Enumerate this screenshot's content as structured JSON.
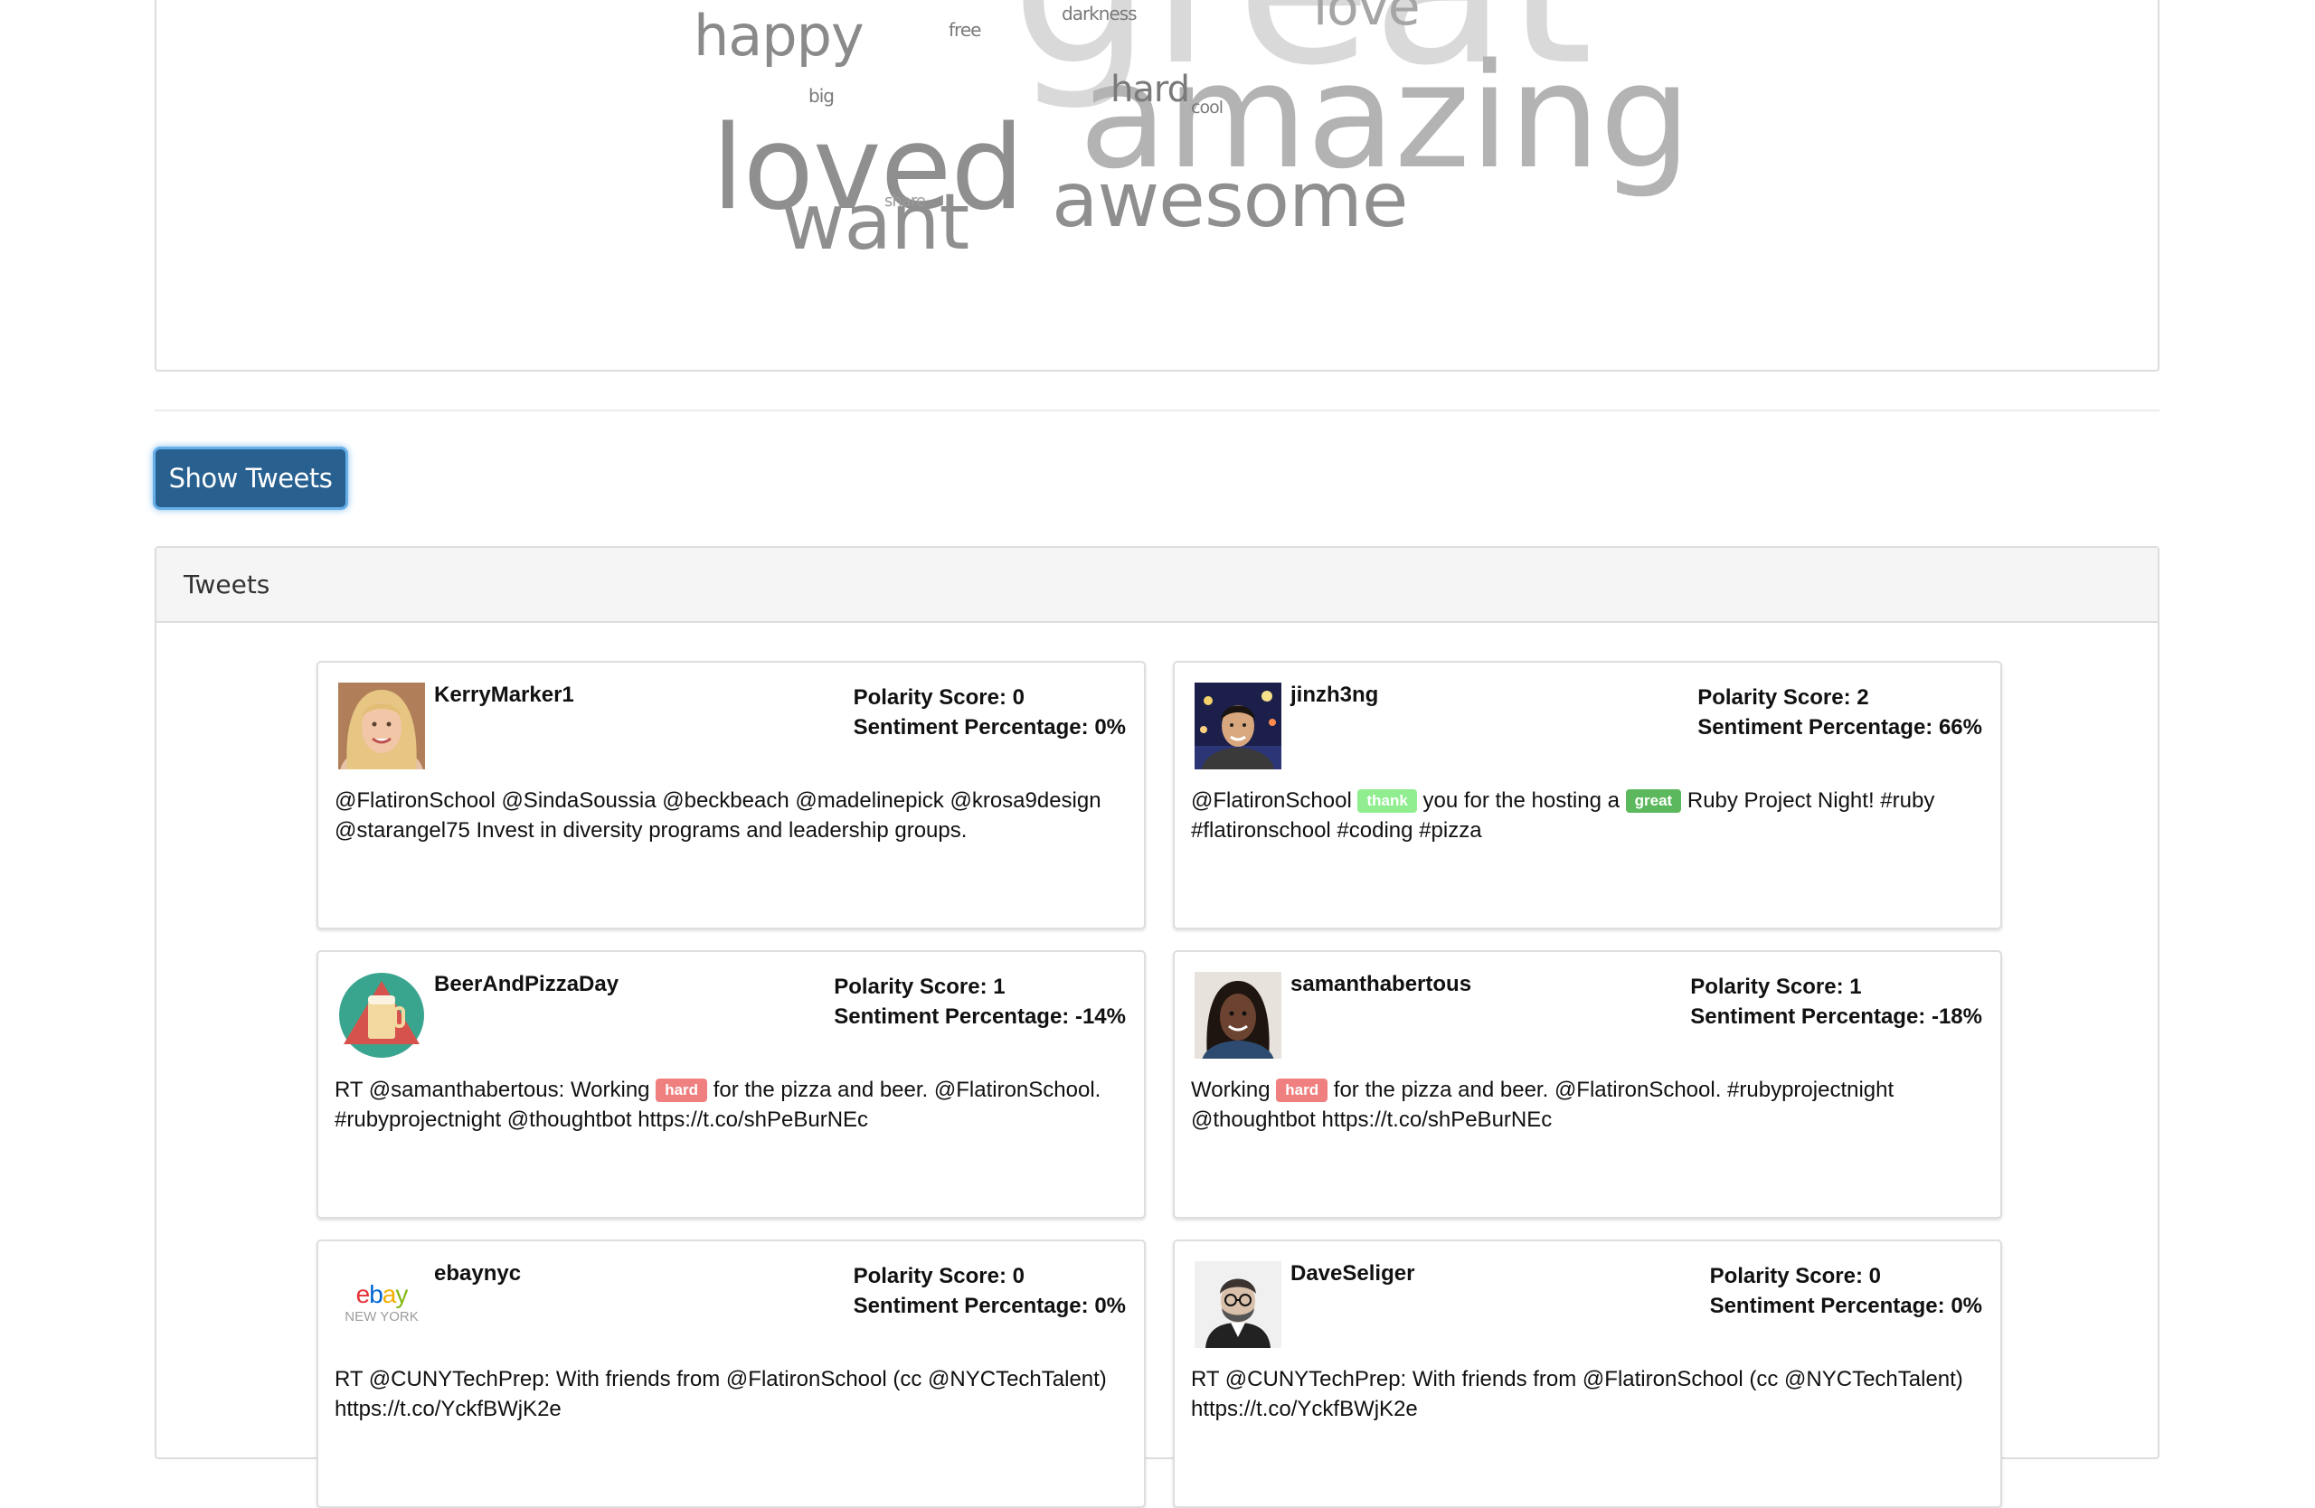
{
  "word_cloud": {
    "words": [
      {
        "text": "great",
        "color": "#d9d9d9"
      },
      {
        "text": "amazing",
        "color": "#b3b3b3"
      },
      {
        "text": "loved",
        "color": "#8f8f8f"
      },
      {
        "text": "want",
        "color": "#8f8f8f"
      },
      {
        "text": "awesome",
        "color": "#8f8f8f"
      },
      {
        "text": "happy",
        "color": "#8a8a8a"
      },
      {
        "text": "love",
        "color": "#a5a5a5"
      },
      {
        "text": "hard",
        "color": "#7a7a7a"
      },
      {
        "text": "darkness",
        "color": "#7a7a7a"
      },
      {
        "text": "free",
        "color": "#7a7a7a"
      },
      {
        "text": "big",
        "color": "#7a7a7a"
      },
      {
        "text": "cool",
        "color": "#7a7a7a"
      },
      {
        "text": "share",
        "color": "#9a9a9a"
      }
    ]
  },
  "show_tweets_button": "Show Tweets",
  "tweets_panel": {
    "title": "Tweets",
    "polarity_label": "Polarity Score:",
    "sentiment_label": "Sentiment Percentage:",
    "cards": [
      {
        "user": "KerryMarker1",
        "polarity": "0",
        "sentiment": "0%",
        "avatar": "kerry",
        "parts": [
          {
            "t": "@FlatironSchool @SindaSoussia @beckbeach @madelinepick @krosa9design @starangel75 Invest in diversity programs and leadership groups."
          }
        ]
      },
      {
        "user": "jinzh3ng",
        "polarity": "2",
        "sentiment": "66%",
        "avatar": "jinzh",
        "parts": [
          {
            "t": "@FlatironSchool "
          },
          {
            "b": "thank",
            "c": "#90ee90"
          },
          {
            "t": " you for the hosting a "
          },
          {
            "b": "great",
            "c": "#5cb85c"
          },
          {
            "t": " Ruby Project Night! #ruby #flatironschool #coding #pizza"
          }
        ]
      },
      {
        "user": "BeerAndPizzaDay",
        "polarity": "1",
        "sentiment": "-14%",
        "avatar": "beer",
        "parts": [
          {
            "t": "RT @samanthabertous: Working "
          },
          {
            "b": "hard",
            "c": "#f08080"
          },
          {
            "t": " for the pizza and beer. @FlatironSchool. #rubyprojectnight @thoughtbot https://t.co/shPeBurNEc"
          }
        ]
      },
      {
        "user": "samanthabertous",
        "polarity": "1",
        "sentiment": "-18%",
        "avatar": "samantha",
        "parts": [
          {
            "t": "Working "
          },
          {
            "b": "hard",
            "c": "#f08080"
          },
          {
            "t": " for the pizza and beer. @FlatironSchool. #rubyprojectnight @thoughtbot https://t.co/shPeBurNEc"
          }
        ]
      },
      {
        "user": "ebaynyc",
        "polarity": "0",
        "sentiment": "0%",
        "avatar": "ebay",
        "parts": [
          {
            "t": "RT @CUNYTechPrep: With friends from @FlatironSchool (cc @NYCTechTalent) https://t.co/YckfBWjK2e"
          }
        ]
      },
      {
        "user": "DaveSeliger",
        "polarity": "0",
        "sentiment": "0%",
        "avatar": "dave",
        "parts": [
          {
            "t": "RT @CUNYTechPrep: With friends from @FlatironSchool (cc @NYCTechTalent) https://t.co/YckfBWjK2e"
          }
        ]
      }
    ]
  },
  "ebay_logo": {
    "brand": "ebay",
    "city": "NEW YORK"
  }
}
